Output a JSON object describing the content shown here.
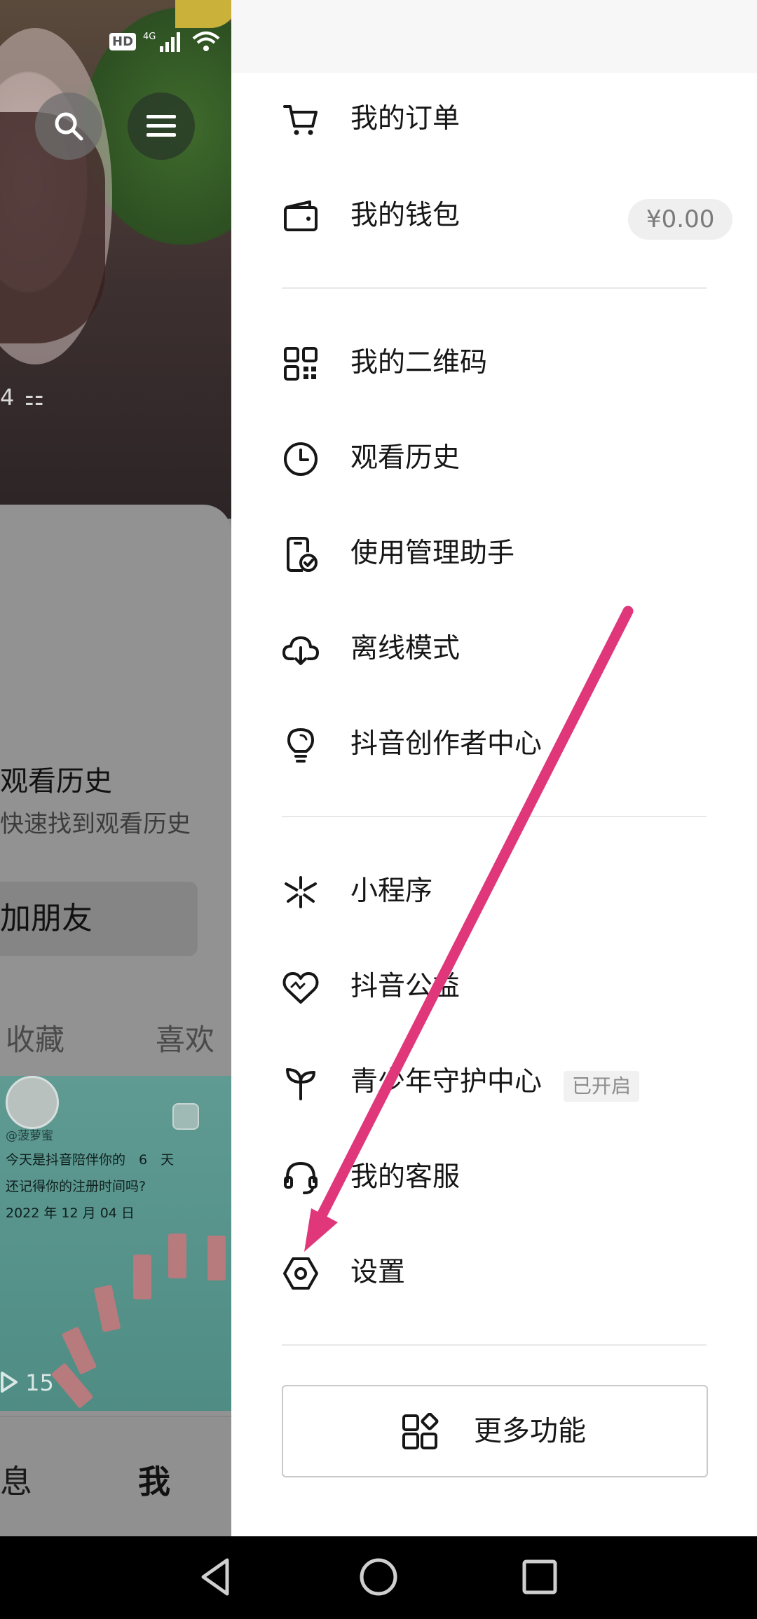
{
  "background_page": {
    "banner_count": "4 ⚏",
    "card_title": "观看历史",
    "card_subtitle": "快速找到观看历史",
    "add_friend_label": "加朋友",
    "tabs": [
      "收藏",
      "喜欢"
    ],
    "video": {
      "user": "@菠萝蜜",
      "line1": "今天是抖音陪伴你的　6　天",
      "line2": "还记得你的注册时间吗?",
      "line3": "2022 年 12 月 04 日",
      "views": "15"
    },
    "bottom_nav": {
      "messages": "消息",
      "me": "我"
    }
  },
  "drawer": {
    "items": [
      {
        "label": "我的订单",
        "icon": "cart-icon"
      },
      {
        "label": "我的钱包",
        "icon": "wallet-icon",
        "badge": "¥0.00"
      },
      {
        "label": "我的二维码",
        "icon": "qr-code-icon"
      },
      {
        "label": "观看历史",
        "icon": "clock-icon"
      },
      {
        "label": "使用管理助手",
        "icon": "phone-check-icon"
      },
      {
        "label": "离线模式",
        "icon": "cloud-download-icon"
      },
      {
        "label": "抖音创作者中心",
        "icon": "lightbulb-icon"
      },
      {
        "label": "小程序",
        "icon": "mini-program-icon"
      },
      {
        "label": "抖音公益",
        "icon": "heart-charity-icon"
      },
      {
        "label": "青少年守护中心",
        "icon": "sprout-icon",
        "badge": "已开启"
      },
      {
        "label": "我的客服",
        "icon": "headset-icon"
      },
      {
        "label": "设置",
        "icon": "settings-hex-icon"
      }
    ],
    "more_button": "更多功能"
  },
  "colors": {
    "arrow": "#E0367A",
    "drawer_bg": "#FFFFFF",
    "overlay_dim": "#8A8A8A"
  }
}
